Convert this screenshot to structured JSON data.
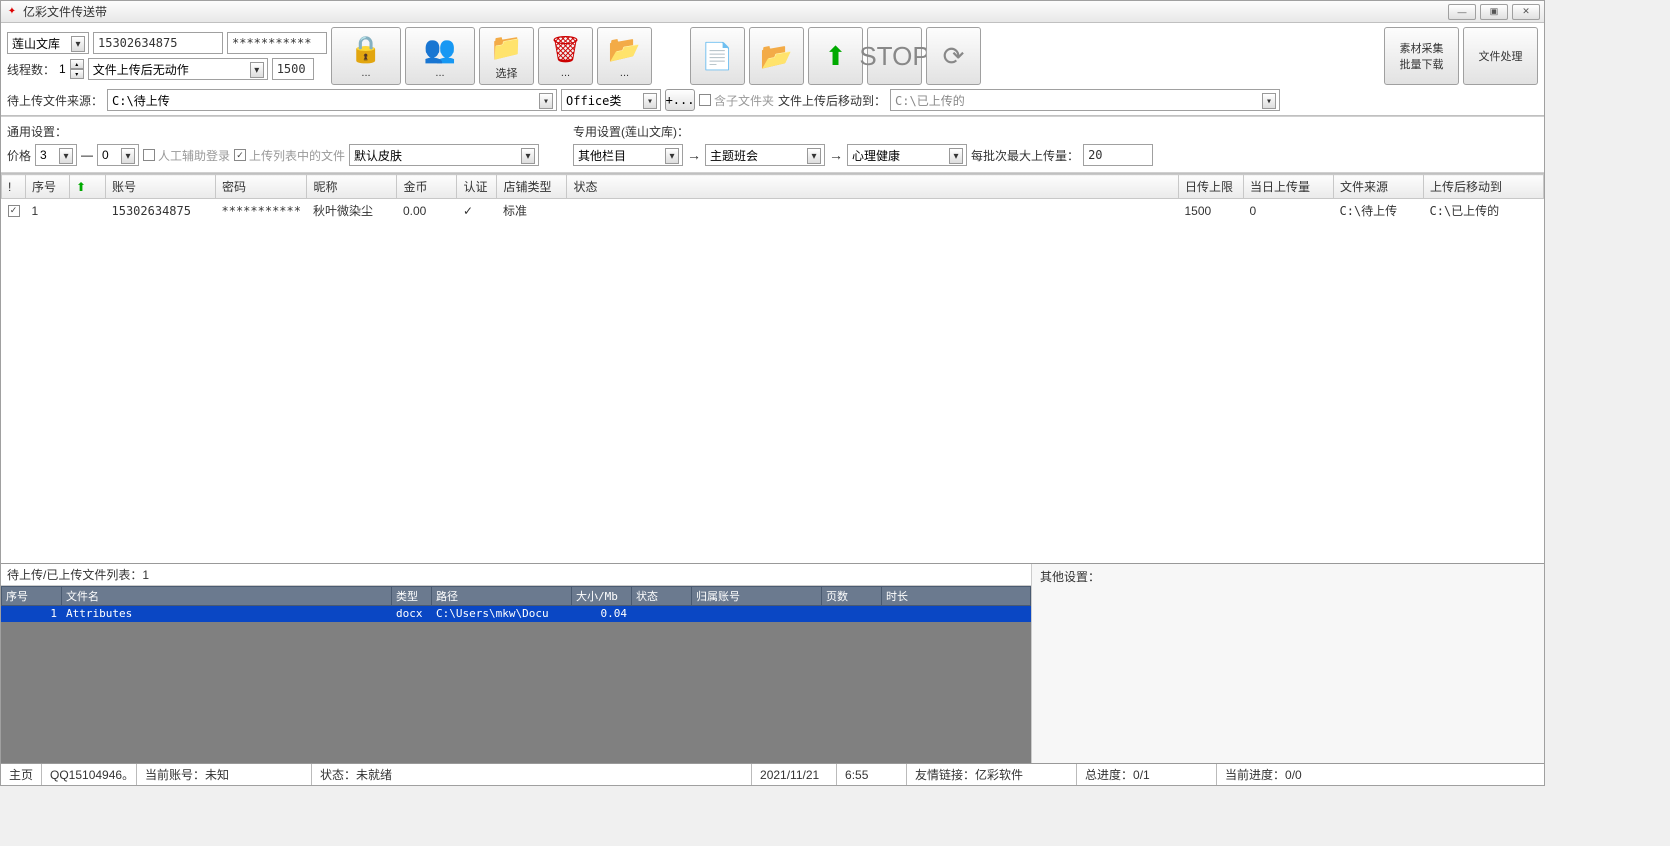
{
  "title": "亿彩文件传送带",
  "topleft": {
    "library": "莲山文库",
    "account": "15302634875",
    "password": "***********",
    "thread_label": "线程数：",
    "thread_value": "1",
    "action_after": "文件上传后无动作",
    "num1500": "1500"
  },
  "buttons": {
    "select": "选择",
    "dots": "...",
    "material": "素材采集\n批量下载",
    "fileproc": "文件处理"
  },
  "row2": {
    "src_label": "待上传文件来源：",
    "src_path": "C:\\待上传",
    "type": "Office类",
    "plus": "+...",
    "subfolder": "含子文件夹",
    "moveto_label": "文件上传后移动到：",
    "moveto_path": "C:\\已上传的"
  },
  "settings": {
    "common_label": "通用设置：",
    "price_label": "价格",
    "price_from": "3",
    "price_to": "0",
    "manual": "人工辅助登录",
    "uploadlist": "上传列表中的文件",
    "skin": "默认皮肤",
    "special_label": "专用设置(莲山文库)：",
    "cat1": "其他栏目",
    "cat2": "主题班会",
    "cat3": "心理健康",
    "batch_label": "每批次最大上传量：",
    "batch_val": "20"
  },
  "table": {
    "headers": [
      "!",
      "序号",
      "",
      "账号",
      "密码",
      "昵称",
      "金币",
      "认证",
      "店铺类型",
      "状态",
      "日传上限",
      "当日上传量",
      "文件来源",
      "上传后移动到"
    ],
    "row": {
      "seq": "1",
      "account": "15302634875",
      "password": "***********",
      "nick": "秋叶微染尘",
      "gold": "0.00",
      "auth": "✓",
      "shoptype": "标准",
      "status": "",
      "daylimit": "1500",
      "uploaded": "0",
      "src": "C:\\待上传",
      "dst": "C:\\已上传的"
    }
  },
  "filelist": {
    "label": "待上传/已上传文件列表：",
    "count": "1",
    "headers": [
      "序号",
      "文件名",
      "类型",
      "路径",
      "大小/Mb",
      "状态",
      "归属账号",
      "页数",
      "时长"
    ],
    "row": {
      "seq": "1",
      "name": "Attributes",
      "type": "docx",
      "path": "C:\\Users\\mkw\\Docu",
      "size": "0.04"
    }
  },
  "other_label": "其他设置：",
  "status": {
    "home": "主页",
    "qq": "QQ15104946。",
    "curacc_label": "当前账号：",
    "curacc": "未知",
    "state_label": "状态：",
    "state": "未就绪",
    "date": "2021/11/21",
    "time": "6:55",
    "links_label": "友情链接：",
    "links": "亿彩软件",
    "total_label": "总进度：",
    "total": "0/1",
    "cur_label": "当前进度：",
    "cur": "0/0"
  }
}
